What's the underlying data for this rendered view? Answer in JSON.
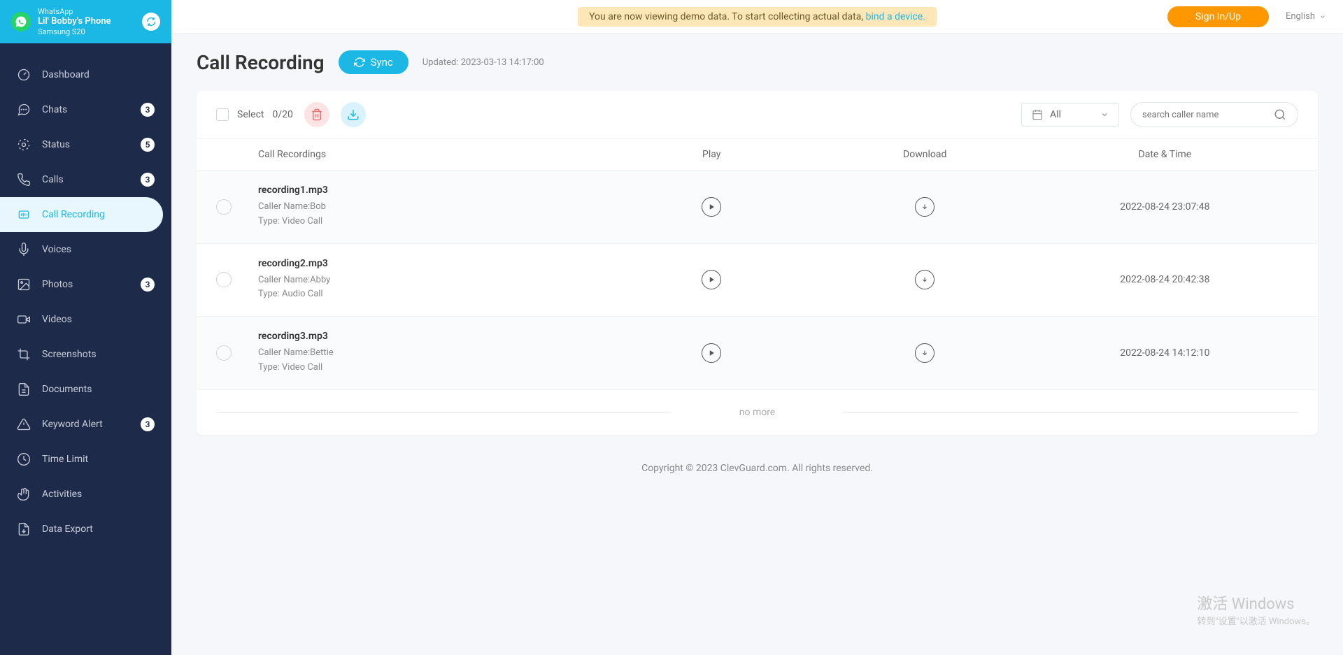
{
  "device": {
    "app_name": "WhatsApp",
    "name": "Lil' Bobby's Phone",
    "model": "Samsung S20"
  },
  "sidebar": {
    "items": [
      {
        "label": "Dashboard",
        "badge": null
      },
      {
        "label": "Chats",
        "badge": "3"
      },
      {
        "label": "Status",
        "badge": "5"
      },
      {
        "label": "Calls",
        "badge": "3"
      },
      {
        "label": "Call Recording",
        "badge": null
      },
      {
        "label": "Voices",
        "badge": null
      },
      {
        "label": "Photos",
        "badge": "3"
      },
      {
        "label": "Videos",
        "badge": null
      },
      {
        "label": "Screenshots",
        "badge": null
      },
      {
        "label": "Documents",
        "badge": null
      },
      {
        "label": "Keyword Alert",
        "badge": "3"
      },
      {
        "label": "Time Limit",
        "badge": null
      },
      {
        "label": "Activities",
        "badge": null
      },
      {
        "label": "Data Export",
        "badge": null
      }
    ]
  },
  "topbar": {
    "banner_text": "You are now viewing demo data. To start collecting actual data, ",
    "banner_link": "bind a device.",
    "signin": "Sign In/Up",
    "language": "English"
  },
  "page": {
    "title": "Call Recording",
    "sync_label": "Sync",
    "updated": "Updated: 2023-03-13 14:17:00"
  },
  "toolbar": {
    "select_label": "Select",
    "select_count": "0/20",
    "filter_value": "All",
    "search_placeholder": "search caller name"
  },
  "columns": {
    "recordings": "Call Recordings",
    "play": "Play",
    "download": "Download",
    "date": "Date & Time"
  },
  "rows": [
    {
      "filename": "recording1.mp3",
      "caller_prefix": "Caller Name:",
      "caller": "Bob",
      "type_prefix": "Type: ",
      "type": "Video Call",
      "date": "2022-08-24 23:07:48"
    },
    {
      "filename": "recording2.mp3",
      "caller_prefix": "Caller Name:",
      "caller": "Abby",
      "type_prefix": "Type: ",
      "type": "Audio Call",
      "date": "2022-08-24 20:42:38"
    },
    {
      "filename": "recording3.mp3",
      "caller_prefix": "Caller Name:",
      "caller": "Bettie",
      "type_prefix": "Type: ",
      "type": "Video Call",
      "date": "2022-08-24 14:12:10"
    }
  ],
  "no_more": "no more",
  "footer": "Copyright © 2023 ClevGuard.com. All rights reserved.",
  "watermark": {
    "title": "激活 Windows",
    "sub": "转到\"设置\"以激活 Windows。"
  }
}
